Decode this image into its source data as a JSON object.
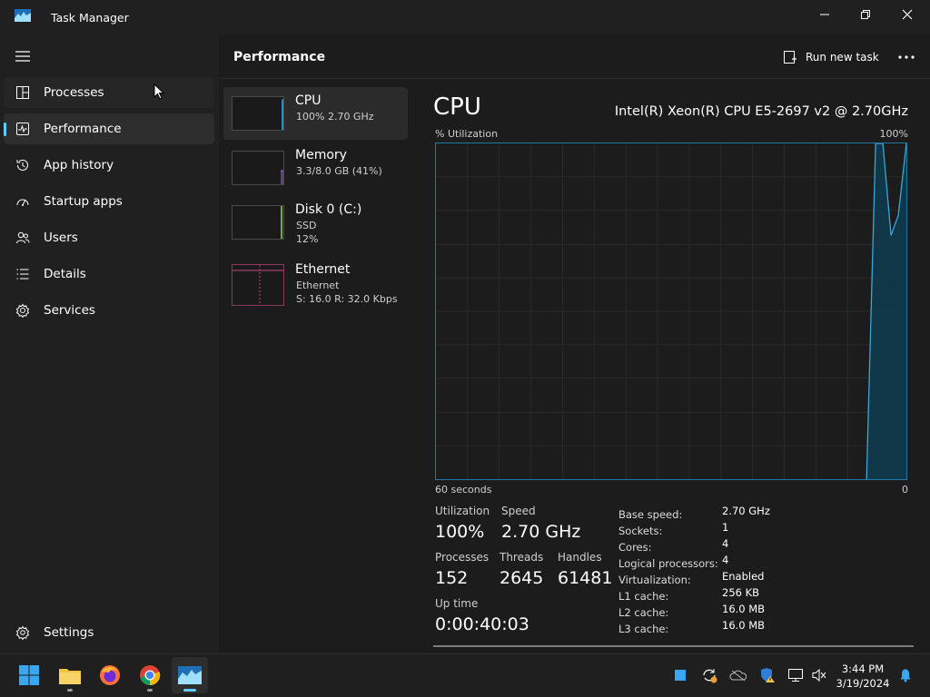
{
  "window": {
    "title": "Task Manager"
  },
  "sidebar": {
    "items": [
      {
        "label": "Processes",
        "icon": "processes-icon"
      },
      {
        "label": "Performance",
        "icon": "performance-icon"
      },
      {
        "label": "App history",
        "icon": "history-icon"
      },
      {
        "label": "Startup apps",
        "icon": "startup-icon"
      },
      {
        "label": "Users",
        "icon": "users-icon"
      },
      {
        "label": "Details",
        "icon": "details-icon"
      },
      {
        "label": "Services",
        "icon": "services-icon"
      }
    ],
    "settings_label": "Settings"
  },
  "header": {
    "title": "Performance",
    "run_task_label": "Run new task"
  },
  "devices": [
    {
      "name": "CPU",
      "line1": "100%  2.70 GHz",
      "line2": ""
    },
    {
      "name": "Memory",
      "line1": "3.3/8.0 GB (41%)",
      "line2": ""
    },
    {
      "name": "Disk 0 (C:)",
      "line1": "SSD",
      "line2": "12%"
    },
    {
      "name": "Ethernet",
      "line1": "Ethernet",
      "line2": "S: 16.0  R: 32.0 Kbps"
    }
  ],
  "detail": {
    "title": "CPU",
    "model": "Intel(R) Xeon(R) CPU E5-2697 v2 @ 2.70GHz",
    "graph_label": "% Utilization",
    "graph_max": "100%",
    "graph_left": "60 seconds",
    "graph_right": "0",
    "utilization_label": "Utilization",
    "utilization_value": "100%",
    "speed_label": "Speed",
    "speed_value": "2.70 GHz",
    "processes_label": "Processes",
    "processes_value": "152",
    "threads_label": "Threads",
    "threads_value": "2645",
    "handles_label": "Handles",
    "handles_value": "61481",
    "uptime_label": "Up time",
    "uptime_value": "0:00:40:03",
    "specs": [
      {
        "k": "Base speed:",
        "v": "2.70 GHz"
      },
      {
        "k": "Sockets:",
        "v": "1"
      },
      {
        "k": "Cores:",
        "v": "4"
      },
      {
        "k": "Logical processors:",
        "v": "4"
      },
      {
        "k": "Virtualization:",
        "v": "Enabled"
      },
      {
        "k": "L1 cache:",
        "v": "256 KB"
      },
      {
        "k": "L2 cache:",
        "v": "16.0 MB"
      },
      {
        "k": "L3 cache:",
        "v": "16.0 MB"
      }
    ]
  },
  "taskbar": {
    "clock_time": "3:44 PM",
    "clock_date": "3/19/2024"
  },
  "colors": {
    "accent": "#60cdff",
    "cpu_graph": "#1d7aa3"
  }
}
